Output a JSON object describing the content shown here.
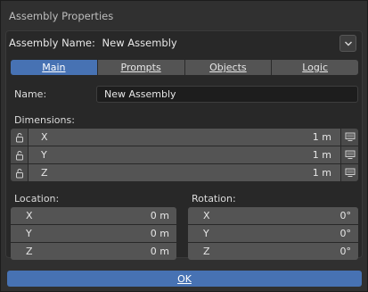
{
  "dialog": {
    "title": "Assembly Properties"
  },
  "header": {
    "name_label": "Assembly Name:",
    "name_value": "New Assembly"
  },
  "tabs": [
    {
      "label": "Main",
      "active": true
    },
    {
      "label": "Prompts",
      "active": false
    },
    {
      "label": "Objects",
      "active": false
    },
    {
      "label": "Logic",
      "active": false
    }
  ],
  "main": {
    "name_label": "Name:",
    "name_value": "New Assembly",
    "dimensions_label": "Dimensions:",
    "dimensions": [
      {
        "axis": "X",
        "value": "1 m"
      },
      {
        "axis": "Y",
        "value": "1 m"
      },
      {
        "axis": "Z",
        "value": "1 m"
      }
    ],
    "location_label": "Location:",
    "location": [
      {
        "axis": "X",
        "value": "0 m"
      },
      {
        "axis": "Y",
        "value": "0 m"
      },
      {
        "axis": "Z",
        "value": "0 m"
      }
    ],
    "rotation_label": "Rotation:",
    "rotation": [
      {
        "axis": "X",
        "value": "0°"
      },
      {
        "axis": "Y",
        "value": "0°"
      },
      {
        "axis": "Z",
        "value": "0°"
      }
    ]
  },
  "footer": {
    "ok_label": "OK"
  },
  "icons": {
    "dropdown": "chevron-down-icon",
    "lock": "unlock-icon",
    "monitor": "monitor-icon"
  },
  "colors": {
    "accent": "#4772b3",
    "background": "#303030",
    "field": "#545454"
  }
}
